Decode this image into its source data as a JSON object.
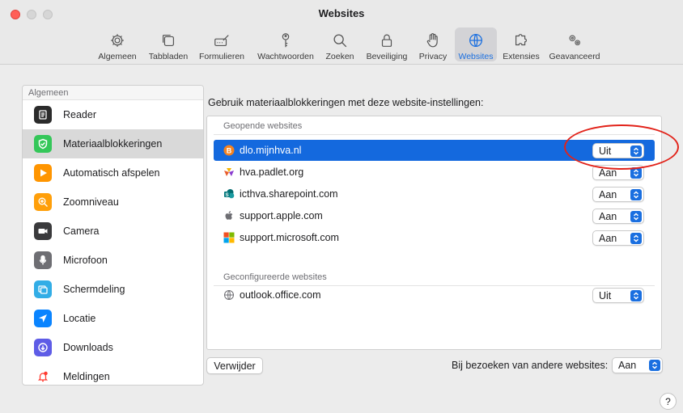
{
  "window": {
    "title": "Websites"
  },
  "toolbar": {
    "items": [
      {
        "label": "Algemeen",
        "icon": "gear-icon"
      },
      {
        "label": "Tabbladen",
        "icon": "tabs-icon"
      },
      {
        "label": "Formulieren",
        "icon": "form-pencil-icon"
      },
      {
        "label": "Wachtwoorden",
        "icon": "key-icon"
      },
      {
        "label": "Zoeken",
        "icon": "search-icon"
      },
      {
        "label": "Beveiliging",
        "icon": "lock-icon"
      },
      {
        "label": "Privacy",
        "icon": "hand-icon"
      },
      {
        "label": "Websites",
        "icon": "globe-icon",
        "active": true
      },
      {
        "label": "Extensies",
        "icon": "puzzle-icon"
      },
      {
        "label": "Geavanceerd",
        "icon": "gears-icon"
      }
    ]
  },
  "sidebar": {
    "header": "Algemeen",
    "items": [
      {
        "label": "Reader",
        "icon": "reader-icon",
        "color": "#2b2b2b"
      },
      {
        "label": "Materiaalblokkeringen",
        "icon": "shield-check-icon",
        "color": "#34c759",
        "selected": true
      },
      {
        "label": "Automatisch afspelen",
        "icon": "play-icon",
        "color": "#ff9500"
      },
      {
        "label": "Zoomniveau",
        "icon": "zoom-icon",
        "color": "#ff9f0a"
      },
      {
        "label": "Camera",
        "icon": "camera-icon",
        "color": "#3a3a3c"
      },
      {
        "label": "Microfoon",
        "icon": "microphone-icon",
        "color": "#6e6e73"
      },
      {
        "label": "Schermdeling",
        "icon": "screen-share-icon",
        "color": "#32ade6"
      },
      {
        "label": "Locatie",
        "icon": "location-arrow-icon",
        "color": "#0a84ff"
      },
      {
        "label": "Downloads",
        "icon": "download-icon",
        "color": "#5e5ce6"
      },
      {
        "label": "Meldingen",
        "icon": "bell-icon",
        "color": "#ff3b30"
      }
    ]
  },
  "main": {
    "heading": "Gebruik materiaalblokkeringen met deze website-instellingen:",
    "open_section_label": "Geopende websites",
    "configured_section_label": "Geconfigureerde websites",
    "open_sites": [
      {
        "domain": "dlo.mijnhva.nl",
        "value": "Uit",
        "selected": true,
        "favicon": "orange-b-favicon"
      },
      {
        "domain": "hva.padlet.org",
        "value": "Aan",
        "favicon": "padlet-favicon"
      },
      {
        "domain": "icthva.sharepoint.com",
        "value": "Aan",
        "favicon": "sharepoint-favicon"
      },
      {
        "domain": "support.apple.com",
        "value": "Aan",
        "favicon": "apple-favicon"
      },
      {
        "domain": "support.microsoft.com",
        "value": "Aan",
        "favicon": "microsoft-favicon"
      }
    ],
    "configured_sites": [
      {
        "domain": "outlook.office.com",
        "value": "Uit",
        "favicon": "globe-favicon"
      }
    ],
    "remove_button": "Verwijder",
    "other_sites_label": "Bij bezoeken van andere websites:",
    "other_sites_value": "Aan",
    "help_label": "?"
  },
  "colors": {
    "accent": "#1469de",
    "annotation_ring": "#e2231a"
  }
}
